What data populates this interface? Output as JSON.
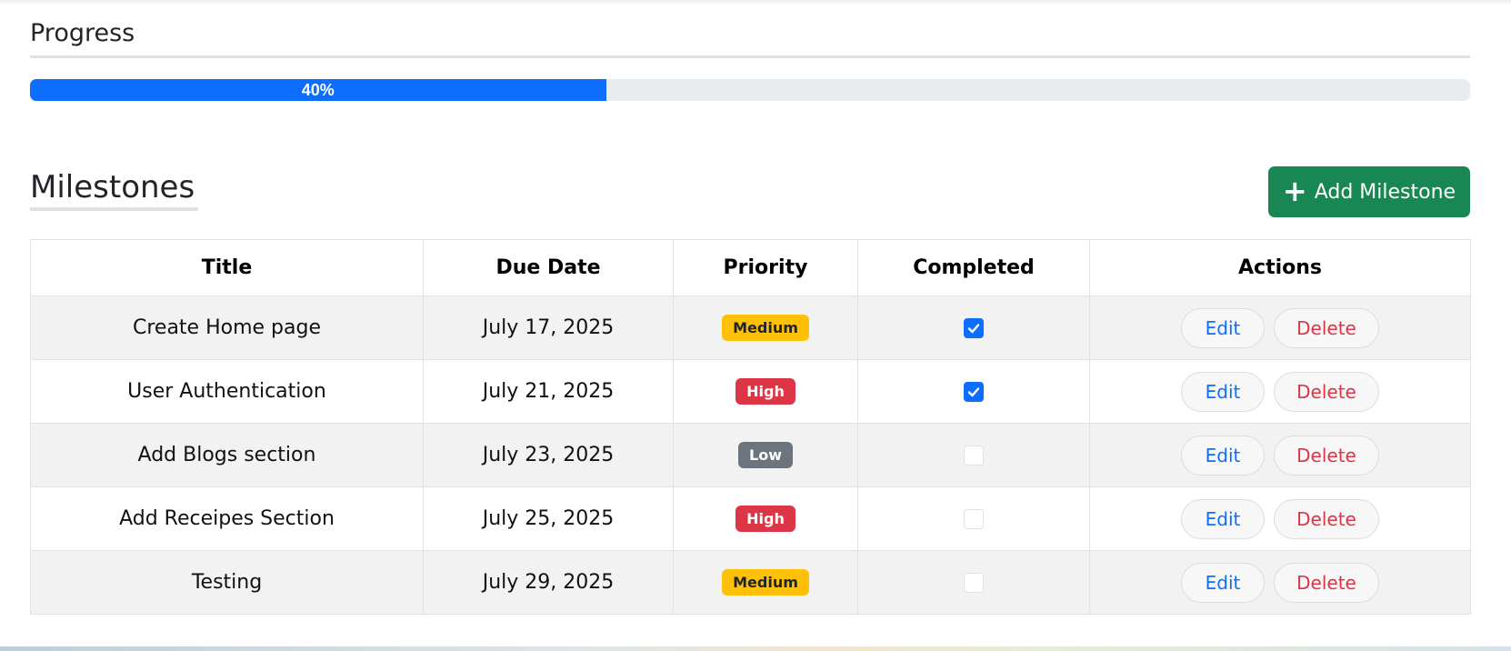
{
  "progress": {
    "heading": "Progress",
    "percent": 40,
    "label": "40%",
    "color": "#0d6efd"
  },
  "milestones": {
    "heading": "Milestones",
    "add_button_label": "Add Milestone",
    "add_button_icon": "plus-icon",
    "columns": [
      "Title",
      "Due Date",
      "Priority",
      "Completed",
      "Actions"
    ],
    "rows": [
      {
        "title": "Create Home page",
        "due": "July 17, 2025",
        "priority": "Medium",
        "completed": true
      },
      {
        "title": "User Authentication",
        "due": "July 21, 2025",
        "priority": "High",
        "completed": true
      },
      {
        "title": "Add Blogs section",
        "due": "July 23, 2025",
        "priority": "Low",
        "completed": false
      },
      {
        "title": "Add Receipes Section",
        "due": "July 25, 2025",
        "priority": "High",
        "completed": false
      },
      {
        "title": "Testing",
        "due": "July 29, 2025",
        "priority": "Medium",
        "completed": false
      }
    ],
    "edit_label": "Edit",
    "delete_label": "Delete"
  },
  "colors": {
    "success": "#198754",
    "priority_medium": "#ffc107",
    "priority_high": "#dc3545",
    "priority_low": "#6c757d",
    "edit": "#0d6efd",
    "delete": "#dc3545"
  }
}
